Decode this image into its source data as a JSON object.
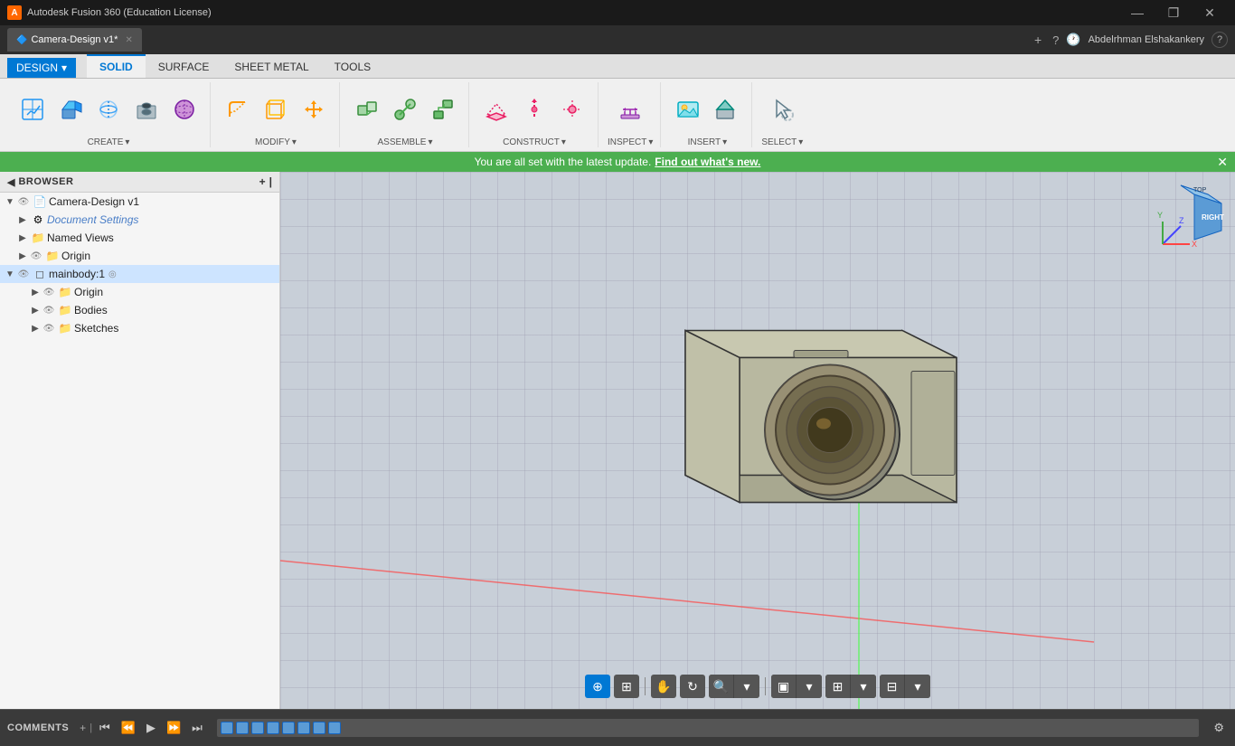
{
  "titlebar": {
    "app_name": "Autodesk Fusion 360 (Education License)",
    "logo_text": "A",
    "win_minimize": "—",
    "win_restore": "❐",
    "win_close": "✕"
  },
  "tabbar": {
    "tab_label": "Camera-Design v1*",
    "tab_close": "✕",
    "new_tab": "+",
    "help_icon": "?",
    "clock_icon": "🕐",
    "user_name": "Abdelrhman Elshakankery",
    "help_btn": "?"
  },
  "ribbon": {
    "design_label": "DESIGN",
    "design_arrow": "▾",
    "tabs": [
      {
        "id": "solid",
        "label": "SOLID",
        "active": true
      },
      {
        "id": "surface",
        "label": "SURFACE"
      },
      {
        "id": "sheet_metal",
        "label": "SHEET METAL"
      },
      {
        "id": "tools",
        "label": "TOOLS"
      }
    ],
    "groups": [
      {
        "id": "create",
        "label": "CREATE",
        "has_arrow": true,
        "items": [
          "create1",
          "create2",
          "create3",
          "create4",
          "create5"
        ]
      },
      {
        "id": "modify",
        "label": "MODIFY",
        "has_arrow": true
      },
      {
        "id": "assemble",
        "label": "ASSEMBLE",
        "has_arrow": true
      },
      {
        "id": "construct",
        "label": "CONSTRUCT",
        "has_arrow": true
      },
      {
        "id": "inspect",
        "label": "INSPECT",
        "has_arrow": true
      },
      {
        "id": "insert",
        "label": "INSERT",
        "has_arrow": true
      },
      {
        "id": "select",
        "label": "SELECT",
        "has_arrow": true
      }
    ]
  },
  "notification": {
    "message": "You are all set with the latest update.",
    "link_text": "Find out what's new.",
    "close": "✕"
  },
  "browser": {
    "title": "BROWSER",
    "collapse_icon": "◀",
    "pin_icon": "|",
    "tree": [
      {
        "id": "root",
        "level": 0,
        "expanded": true,
        "label": "Camera-Design v1",
        "icon": "📄",
        "eye": true,
        "folder": false
      },
      {
        "id": "doc_settings",
        "level": 1,
        "expanded": false,
        "label": "Document Settings",
        "icon": "⚙",
        "eye": false,
        "folder": false
      },
      {
        "id": "named_views",
        "level": 1,
        "expanded": false,
        "label": "Named Views",
        "icon": "📁",
        "eye": false,
        "folder": true
      },
      {
        "id": "origin",
        "level": 1,
        "expanded": false,
        "label": "Origin",
        "icon": "📁",
        "eye": true,
        "folder": true
      },
      {
        "id": "mainbody",
        "level": 0,
        "expanded": true,
        "label": "mainbody:1",
        "icon": "◉",
        "eye": true,
        "folder": false,
        "selected": true
      },
      {
        "id": "mb_origin",
        "level": 2,
        "expanded": false,
        "label": "Origin",
        "icon": "📁",
        "eye": true,
        "folder": true
      },
      {
        "id": "mb_bodies",
        "level": 2,
        "expanded": false,
        "label": "Bodies",
        "icon": "📁",
        "eye": true,
        "folder": true
      },
      {
        "id": "mb_sketches",
        "level": 2,
        "expanded": false,
        "label": "Sketches",
        "icon": "📁",
        "eye": true,
        "folder": true
      }
    ]
  },
  "bottom_toolbar": {
    "cursor_icon": "⊕",
    "capture_icon": "⊞",
    "pan_icon": "✋",
    "orbit_icon": "↻",
    "zoom_icon": "🔍",
    "display_icon": "▣",
    "grid_icon": "⊞",
    "layout_icon": "⊟"
  },
  "statusbar": {
    "comments_label": "COMMENTS",
    "pin_icon": "|",
    "settings_icon": "⚙"
  },
  "timeline": {
    "prev_start": "⏮",
    "prev": "⏪",
    "play": "▶",
    "next": "⏩",
    "next_end": "⏭",
    "items": 8
  },
  "viewport": {
    "bg_color": "#c8cfd8"
  }
}
